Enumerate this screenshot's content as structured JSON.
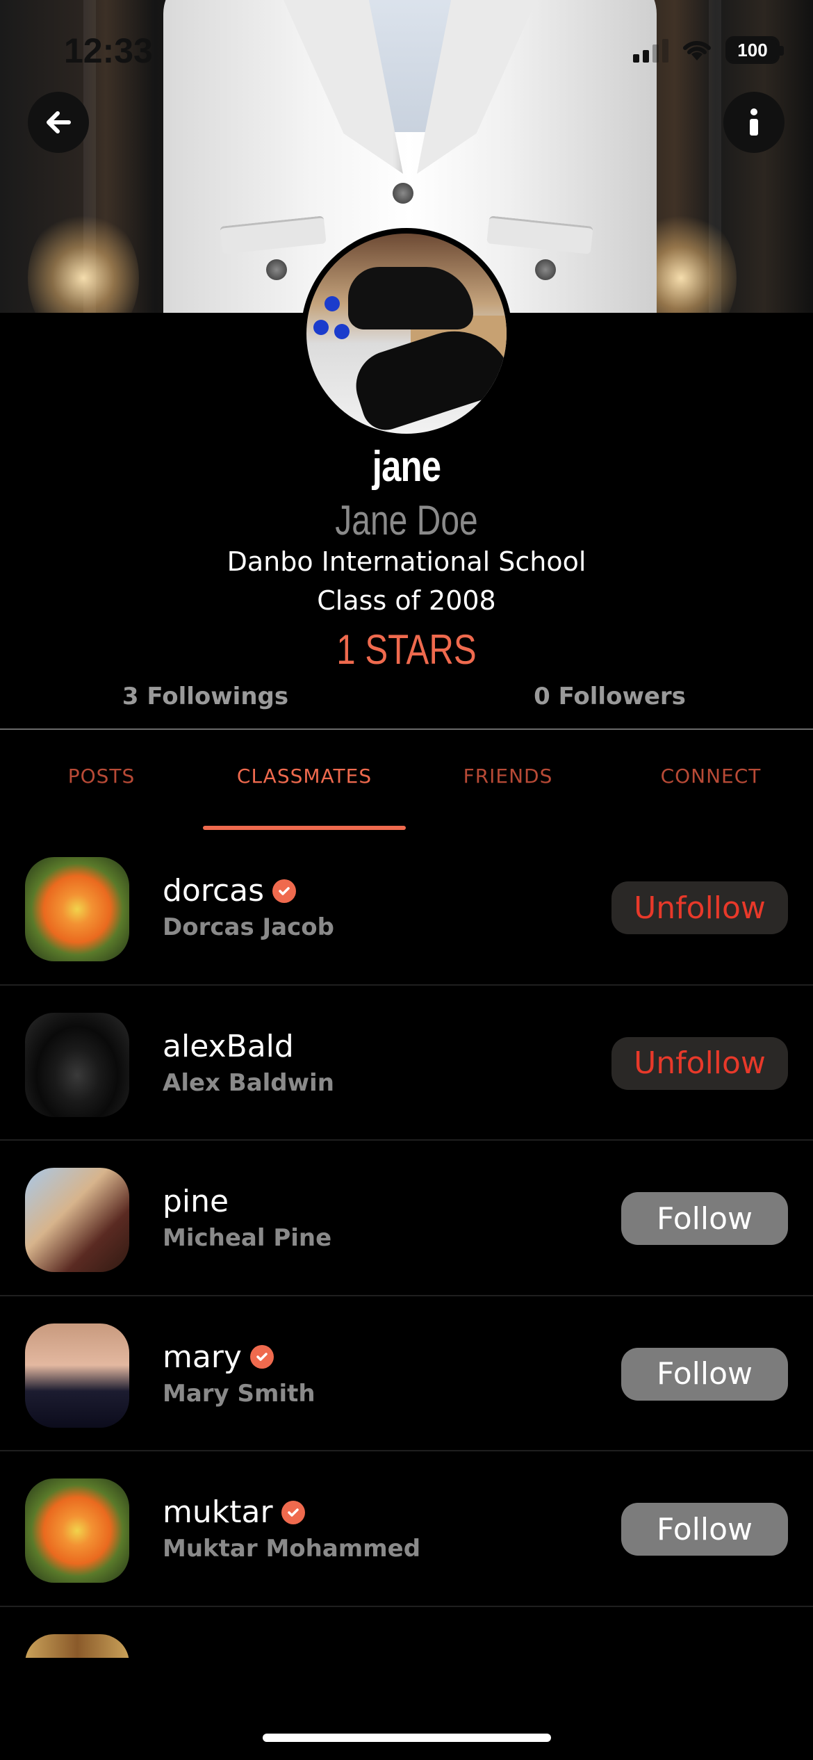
{
  "status": {
    "time": "12:33",
    "battery": "100"
  },
  "profile": {
    "handle": "jane",
    "name": "Jane Doe",
    "school": "Danbo International School",
    "class_of": "Class of 2008",
    "stars": "1 STARS",
    "followings": "3 Followings",
    "followers": "0 Followers"
  },
  "tabs": [
    {
      "label": "POSTS",
      "active": false
    },
    {
      "label": "CLASSMATES",
      "active": true
    },
    {
      "label": "FRIENDS",
      "active": false
    },
    {
      "label": "CONNECT",
      "active": false
    }
  ],
  "classmates": [
    {
      "username": "dorcas",
      "name": "Dorcas Jacob",
      "verified": true,
      "action": "Unfollow",
      "avatar": "flower"
    },
    {
      "username": "alexBald",
      "name": "Alex Baldwin",
      "verified": false,
      "action": "Unfollow",
      "avatar": "hooded-figure"
    },
    {
      "username": "pine",
      "name": "Micheal Pine",
      "verified": false,
      "action": "Follow",
      "avatar": "woman-sunglasses"
    },
    {
      "username": "mary",
      "name": "Mary Smith",
      "verified": true,
      "action": "Follow",
      "avatar": "masked-eyes"
    },
    {
      "username": "muktar",
      "name": "Muktar Mohammed",
      "verified": true,
      "action": "Follow",
      "avatar": "flower"
    }
  ],
  "icons": {
    "back": "arrow-left-icon",
    "info": "info-icon",
    "verified": "verified-check-icon"
  },
  "colors": {
    "accent": "#ef6a4e",
    "unfollow_text": "#e8392a",
    "follow_bg": "#7c7c7c",
    "background": "#000000"
  }
}
